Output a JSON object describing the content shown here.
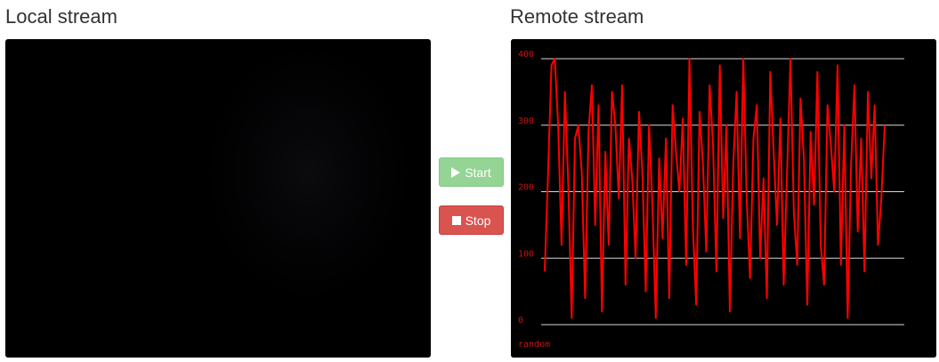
{
  "local": {
    "heading": "Local stream"
  },
  "remote": {
    "heading": "Remote stream"
  },
  "controls": {
    "start_label": "Start",
    "stop_label": "Stop",
    "start_icon": "play-icon",
    "stop_icon": "stop-icon"
  },
  "colors": {
    "start_button": "#94d494",
    "stop_button": "#d9534f",
    "plot_line": "#ff0000",
    "grid_line": "#d8d8d8",
    "plot_background": "#000000"
  },
  "chart_data": {
    "type": "line",
    "title": "",
    "xlabel": "",
    "ylabel": "",
    "ylim": [
      0,
      400
    ],
    "yticks": [
      0,
      100,
      200,
      300,
      400
    ],
    "grid": true,
    "legend": "bottom-left",
    "series": [
      {
        "name": "random",
        "values": [
          80,
          230,
          390,
          400,
          300,
          120,
          350,
          210,
          10,
          280,
          300,
          230,
          40,
          290,
          360,
          150,
          330,
          20,
          260,
          120,
          350,
          300,
          190,
          360,
          60,
          280,
          220,
          100,
          320,
          230,
          50,
          300,
          180,
          10,
          250,
          130,
          280,
          40,
          330,
          260,
          200,
          310,
          90,
          400,
          150,
          30,
          320,
          240,
          110,
          360,
          270,
          80,
          390,
          160,
          300,
          20,
          240,
          350,
          130,
          400,
          190,
          70,
          280,
          330,
          100,
          220,
          40,
          380,
          260,
          150,
          310,
          60,
          230,
          400,
          170,
          90,
          340,
          250,
          30,
          290,
          180,
          380,
          120,
          60,
          330,
          270,
          200,
          390,
          90,
          300,
          10,
          240,
          360,
          140,
          280,
          80,
          350,
          220,
          330,
          120,
          190,
          300
        ]
      }
    ]
  }
}
